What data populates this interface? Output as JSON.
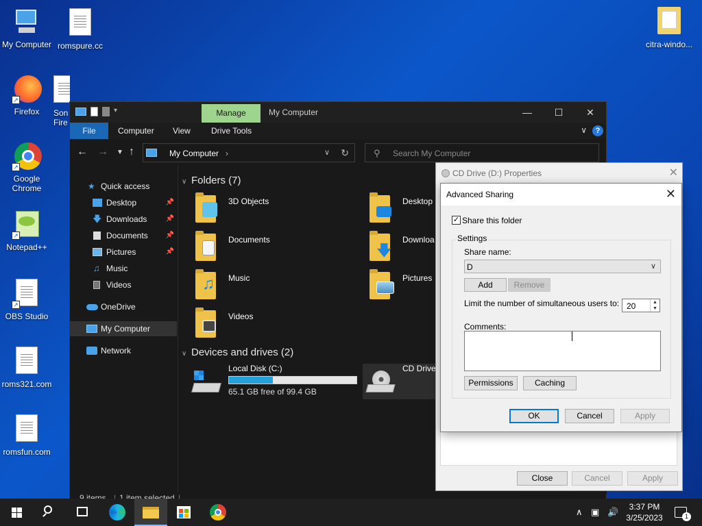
{
  "desktop": {
    "icons": [
      {
        "label": "My Computer"
      },
      {
        "label": "romspure.cc"
      },
      {
        "label": "Firefox"
      },
      {
        "label": "Son Fire"
      },
      {
        "label": "Google Chrome"
      },
      {
        "label": "Notepad++"
      },
      {
        "label": "OBS Studio"
      },
      {
        "label": "roms321.com"
      },
      {
        "label": "romsfun.com"
      },
      {
        "label": "citra-windo..."
      }
    ]
  },
  "explorer": {
    "tab_manage": "Manage",
    "title": "My Computer",
    "ribbon": {
      "file": "File",
      "computer": "Computer",
      "view": "View",
      "drive_tools": "Drive Tools"
    },
    "address": "My Computer",
    "search_placeholder": "Search My Computer",
    "nav": {
      "quick_access": "Quick access",
      "items": [
        "Desktop",
        "Downloads",
        "Documents",
        "Pictures",
        "Music",
        "Videos"
      ],
      "onedrive": "OneDrive",
      "my_computer": "My Computer",
      "network": "Network"
    },
    "folders_header": "Folders (7)",
    "folders": [
      "3D Objects",
      "Desktop",
      "Documents",
      "Downloa",
      "Music",
      "Pictures",
      "Videos"
    ],
    "devices_header": "Devices and drives (2)",
    "drives": [
      {
        "name": "Local Disk (C:)",
        "free": "65.1 GB free of 99.4 GB",
        "used_fraction": 0.345
      },
      {
        "name": "CD Drive"
      }
    ],
    "status": {
      "items": "9 items",
      "selected": "1 item selected"
    }
  },
  "properties": {
    "title": "CD Drive (D:) Properties",
    "close": "Close",
    "cancel": "Cancel",
    "apply": "Apply"
  },
  "advanced_sharing": {
    "title": "Advanced Sharing",
    "share_checkbox": "Share this folder",
    "settings": "Settings",
    "share_name_label": "Share name:",
    "share_name_value": "D",
    "add": "Add",
    "remove": "Remove",
    "limit_label": "Limit the number of simultaneous users to:",
    "limit_value": "20",
    "comments_label": "Comments:",
    "permissions": "Permissions",
    "caching": "Caching",
    "ok": "OK",
    "cancel": "Cancel",
    "apply": "Apply"
  },
  "taskbar": {
    "time": "3:37 PM",
    "date": "3/25/2023",
    "notification_count": "1"
  }
}
